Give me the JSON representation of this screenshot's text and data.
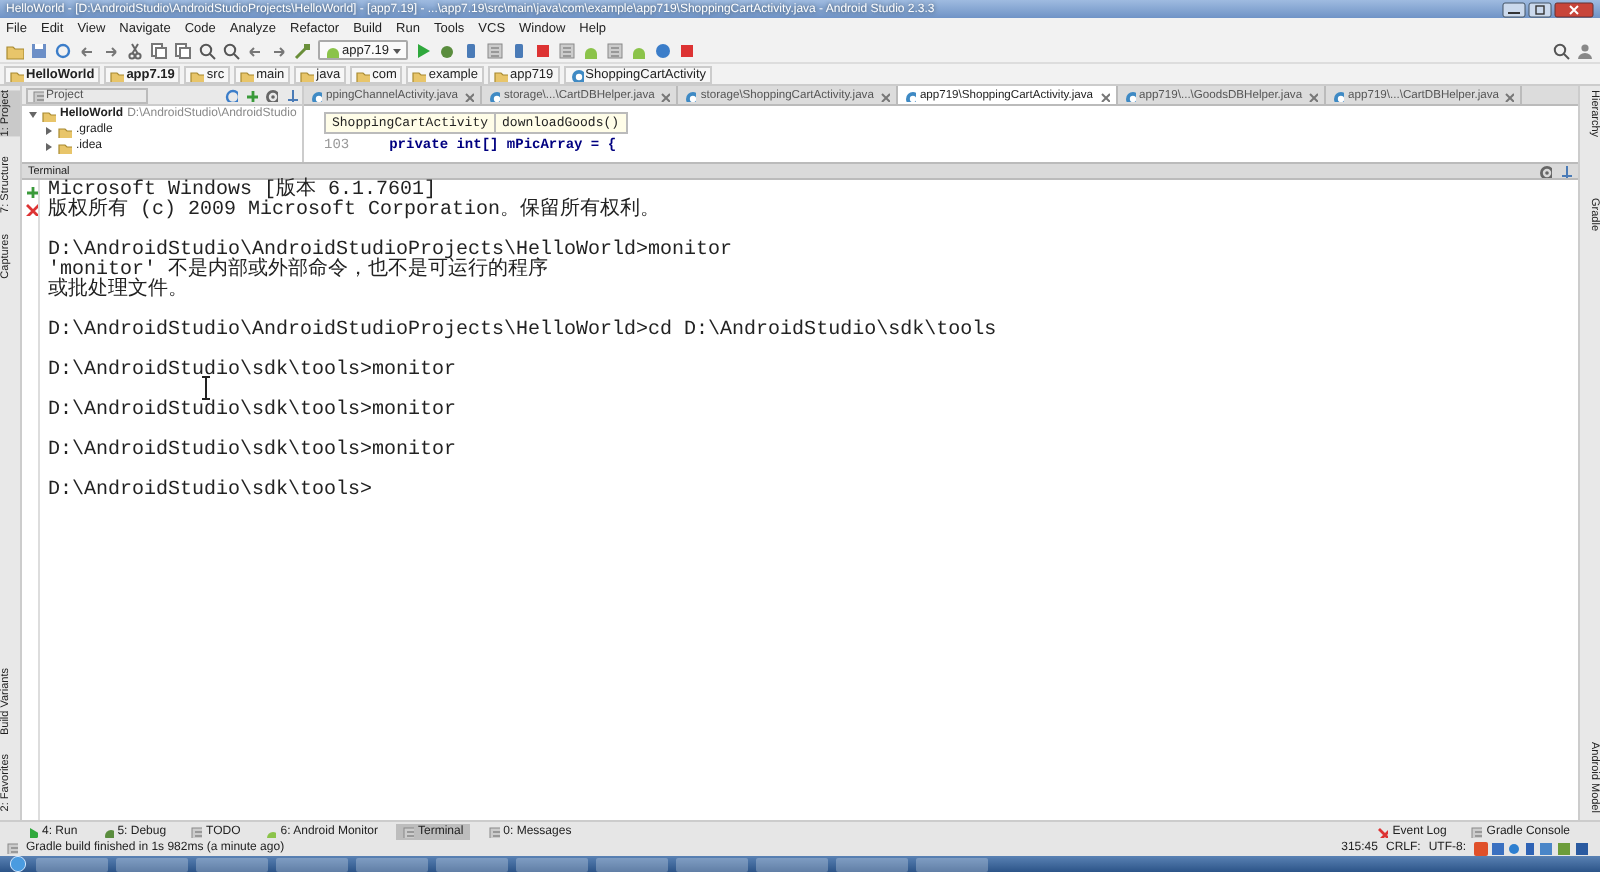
{
  "window": {
    "title": "HelloWorld - [D:\\AndroidStudio\\AndroidStudioProjects\\HelloWorld] - [app7.19] - ...\\app7.19\\src\\main\\java\\com\\example\\app719\\ShoppingCartActivity.java - Android Studio 2.3.3"
  },
  "menu": [
    "File",
    "Edit",
    "View",
    "Navigate",
    "Code",
    "Analyze",
    "Refactor",
    "Build",
    "Run",
    "Tools",
    "VCS",
    "Window",
    "Help"
  ],
  "toolbar": {
    "run_config": "app7.19"
  },
  "breadcrumbs": [
    "HelloWorld",
    "app7.19",
    "src",
    "main",
    "java",
    "com",
    "example",
    "app719",
    "ShoppingCartActivity"
  ],
  "project_panel": {
    "selector": "Project",
    "tree": [
      {
        "label": "HelloWorld",
        "path": "D:\\AndroidStudio\\AndroidStudio",
        "expanded": true,
        "children": [
          {
            "label": ".gradle",
            "expanded": false
          },
          {
            "label": ".idea",
            "expanded": false
          }
        ]
      }
    ]
  },
  "editor_tabs": [
    {
      "label": "ppingChannelActivity.java",
      "selected": false
    },
    {
      "label": "storage\\...\\CartDBHelper.java",
      "selected": false
    },
    {
      "label": "storage\\ShoppingCartActivity.java",
      "selected": false
    },
    {
      "label": "app719\\ShoppingCartActivity.java",
      "selected": true
    },
    {
      "label": "app719\\...\\GoodsDBHelper.java",
      "selected": false
    },
    {
      "label": "app719\\...\\CartDBHelper.java",
      "selected": false
    }
  ],
  "editor": {
    "crumbs": [
      "ShoppingCartActivity",
      "downloadGoods()"
    ],
    "line_number": "103",
    "code": "private int[] mPicArray = {"
  },
  "left_strip": [
    "1: Project",
    "7: Structure",
    "Captures",
    "Build Variants",
    "2: Favorites"
  ],
  "right_strip": [
    "Hierarchy",
    "Gradle",
    "Android Model"
  ],
  "terminal": {
    "title": "Terminal",
    "blocks": [
      [
        "Microsoft Windows [版本 6.1.7601]",
        "版权所有 (c) 2009 Microsoft Corporation。保留所有权利。"
      ],
      [
        "D:\\AndroidStudio\\AndroidStudioProjects\\HelloWorld>monitor",
        "'monitor' 不是内部或外部命令，也不是可运行的程序",
        "或批处理文件。"
      ],
      [
        "D:\\AndroidStudio\\AndroidStudioProjects\\HelloWorld>cd D:\\AndroidStudio\\sdk\\tools"
      ],
      [
        "D:\\AndroidStudio\\sdk\\tools>monitor"
      ],
      [
        "D:\\AndroidStudio\\sdk\\tools>monitor"
      ],
      [
        "D:\\AndroidStudio\\sdk\\tools>monitor"
      ],
      [
        "D:\\AndroidStudio\\sdk\\tools>"
      ]
    ]
  },
  "tool_tabs": [
    {
      "label": "4: Run",
      "selected": false
    },
    {
      "label": "5: Debug",
      "selected": false
    },
    {
      "label": "TODO",
      "selected": false
    },
    {
      "label": "6: Android Monitor",
      "selected": false
    },
    {
      "label": "Terminal",
      "selected": true
    },
    {
      "label": "0: Messages",
      "selected": false
    }
  ],
  "tool_tabs_right": [
    "Event Log",
    "Gradle Console"
  ],
  "status": {
    "message": "Gradle build finished in 1s 982ms (a minute ago)",
    "position": "315:45",
    "line_separator": "CRLF:",
    "encoding": "UTF-8:"
  }
}
